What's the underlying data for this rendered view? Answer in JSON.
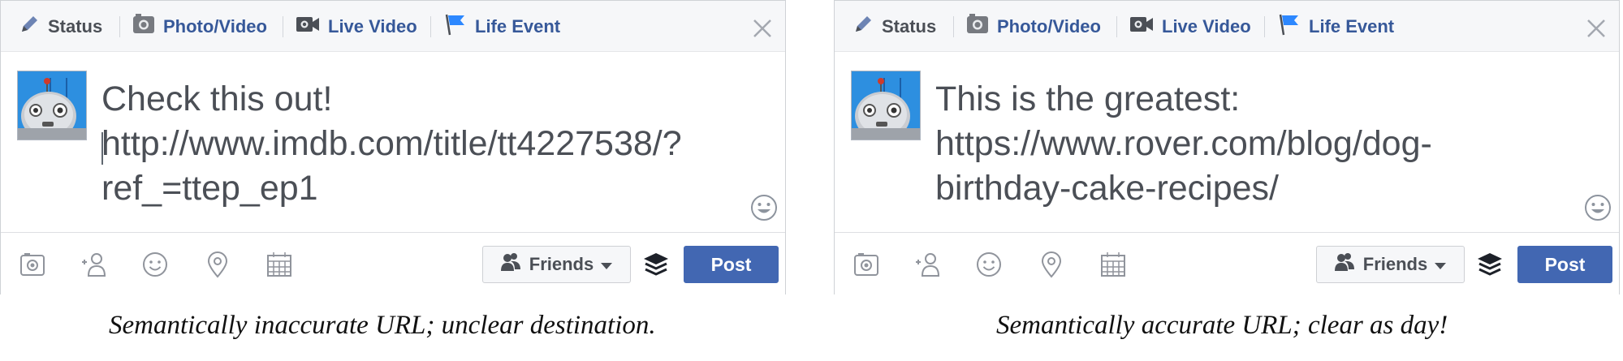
{
  "icons": [
    "pencil-icon",
    "camera-icon",
    "video-camera-icon",
    "flag-icon",
    "close-icon",
    "robot-avatar",
    "smiley-icon",
    "photo-icon",
    "tag-friends-icon",
    "feeling-icon",
    "location-icon",
    "calendar-icon",
    "friends-icon",
    "chevron-down-icon",
    "layers-icon"
  ],
  "colors": {
    "link": "#365899",
    "active_tab": "#4b4f56",
    "post_button": "#4267b2",
    "avatar_bg": "#2d8fe0"
  },
  "panels": [
    {
      "tabs": {
        "status": "Status",
        "photo_video": "Photo/Video",
        "live_video": "Live Video",
        "life_event": "Life Event"
      },
      "post_text": "Check this out!\nhttp://www.imdb.com/title/tt4227538/?\nref_=ttep_ep1",
      "audience": "Friends",
      "post_label": "Post",
      "caption": "Semantically inaccurate URL; unclear destination."
    },
    {
      "tabs": {
        "status": "Status",
        "photo_video": "Photo/Video",
        "live_video": "Live Video",
        "life_event": "Life Event"
      },
      "post_text": "This is the greatest:\nhttps://www.rover.com/blog/dog-\nbirthday-cake-recipes/",
      "audience": "Friends",
      "post_label": "Post",
      "caption": "Semantically accurate URL; clear as day!"
    }
  ]
}
